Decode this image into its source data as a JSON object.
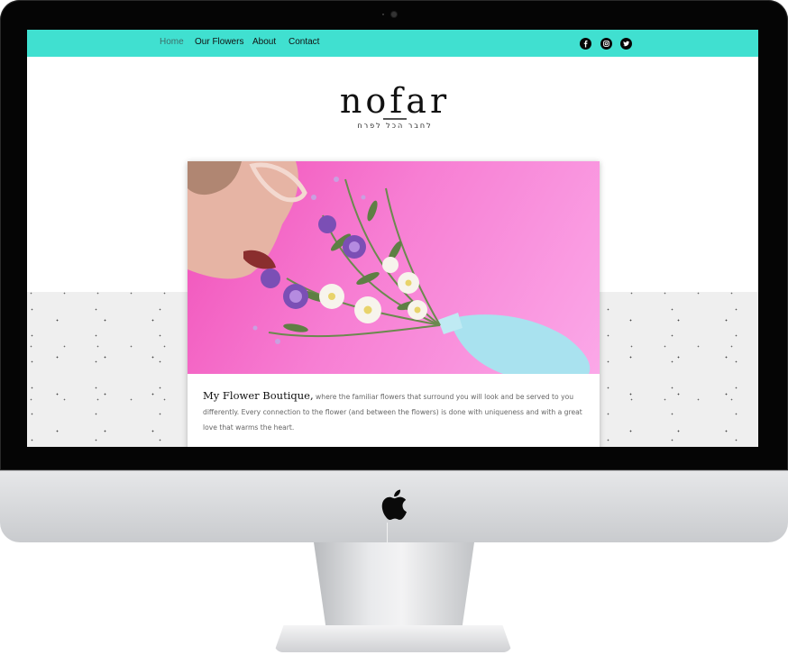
{
  "nav": {
    "items": [
      {
        "label": "Home"
      },
      {
        "label": "Our Flowers"
      },
      {
        "label": "About"
      },
      {
        "label": "Contact"
      }
    ],
    "active": "Home",
    "social_icons": [
      "facebook-icon",
      "instagram-icon",
      "twitter-icon"
    ]
  },
  "logo": {
    "name": "nofar",
    "tagline": "לחבר הכל לפרח"
  },
  "card": {
    "title": "My Flower Boutique,",
    "body": "where the familiar flowers that surround you will look and be served to you differently. Every connection to the flower (and between the flowers) is done with uniqueness and with a great love that warms the heart."
  },
  "colors": {
    "nav_background": "#40e0d0",
    "photo_background": "#f77ed3",
    "band_background": "#efefef"
  }
}
